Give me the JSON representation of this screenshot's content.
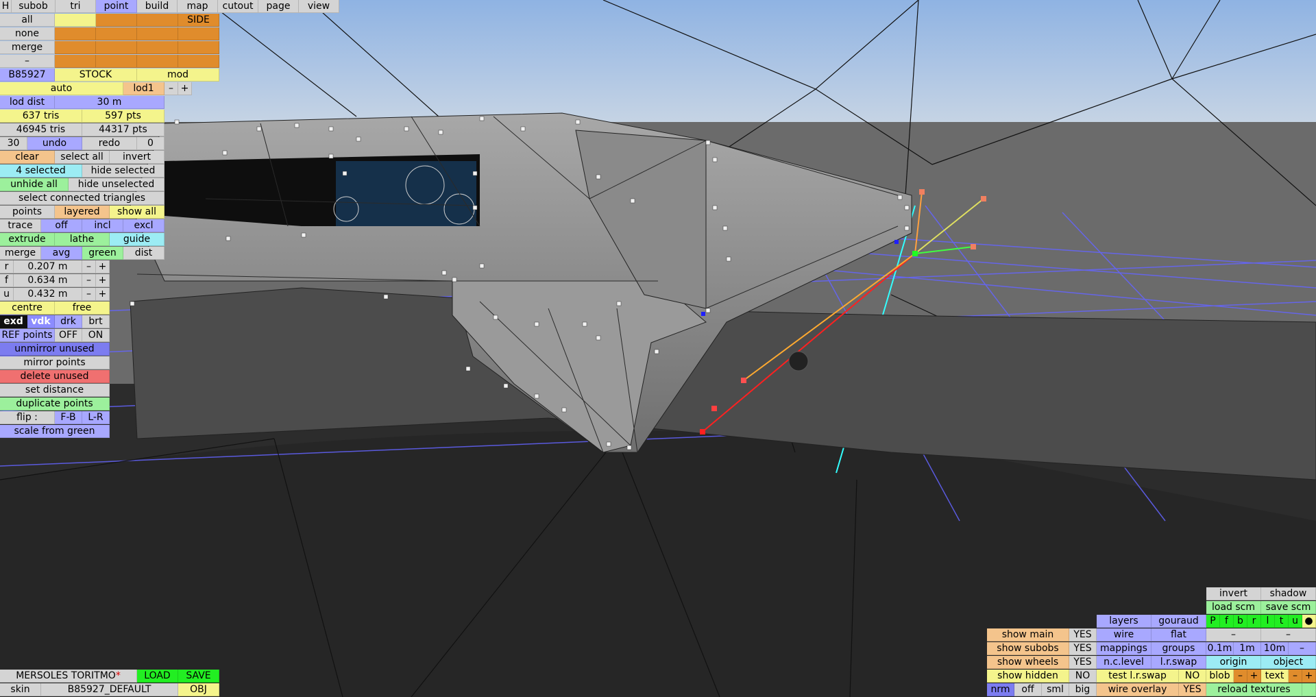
{
  "top_tabs": [
    "H",
    "subob",
    "tri",
    "point",
    "build",
    "map",
    "cutout",
    "page",
    "view"
  ],
  "active_tab": "point",
  "sel_rows": [
    {
      "label": "all",
      "tag": "SIDE"
    },
    {
      "label": "none"
    },
    {
      "label": "merge"
    },
    {
      "label": "–"
    }
  ],
  "car_id": "B85927",
  "stock_label": "STOCK",
  "mod_label": "mod",
  "auto_label": "auto",
  "lod_label": "lod1",
  "minus": "–",
  "plus": "+",
  "lod_dist_label": "lod dist",
  "lod_dist_value": "30 m",
  "tris_lod": "637 tris",
  "pts_lod": "597 pts",
  "tris_total": "46945 tris",
  "pts_total": "44317 pts",
  "undo_count": "30",
  "undo": "undo",
  "redo": "redo",
  "redo_count": "0",
  "clear": "clear",
  "select_all": "select all",
  "invert": "invert",
  "selected_count": "4 selected",
  "hide_selected": "hide selected",
  "unhide_all": "unhide all",
  "hide_unselected": "hide unselected",
  "select_connected": "select connected triangles",
  "points": "points",
  "layered": "layered",
  "show_all": "show all",
  "trace": "trace",
  "off": "off",
  "incl": "incl",
  "excl": "excl",
  "extrude": "extrude",
  "lathe": "lathe",
  "guide": "guide",
  "merge": "merge",
  "avg": "avg",
  "green": "green",
  "dist": "dist",
  "coords": [
    {
      "axis": "r",
      "value": "0.207 m"
    },
    {
      "axis": "f",
      "value": "0.634 m"
    },
    {
      "axis": "u",
      "value": "0.432 m"
    }
  ],
  "centre": "centre",
  "free": "free",
  "exd": "exd",
  "vdk": "vdk",
  "drk": "drk",
  "brt": "brt",
  "ref_points": "REF points",
  "ref_off": "OFF",
  "ref_on": "ON",
  "unmirror_unused": "unmirror unused",
  "mirror_points": "mirror points",
  "delete_unused": "delete unused",
  "set_distance": "set distance",
  "duplicate_points": "duplicate points",
  "flip": "flip :",
  "flip_fb": "F-B",
  "flip_lr": "L-R",
  "scale_from_green": "scale from green",
  "car_name": "MERSOLES TORITMO",
  "modified_mark": "*",
  "load": "LOAD",
  "save": "SAVE",
  "skin_label": "skin",
  "skin_value": "B85927_DEFAULT",
  "obj": "OBJ",
  "br": {
    "invert": "invert",
    "shadow": "shadow",
    "load_scm": "load scm",
    "save_scm": "save scm",
    "layers": "layers",
    "gouraud": "gouraud",
    "layer_flags": [
      "P",
      "f",
      "b",
      "r",
      "l",
      "t",
      "u",
      "●"
    ],
    "wire": "wire",
    "flat": "flat",
    "mappings": "mappings",
    "groups": "groups",
    "steps": [
      "0.1m",
      "1m",
      "10m",
      "–"
    ],
    "nclevel": "n.c.level",
    "lrswap": "l.r.swap",
    "origin": "origin",
    "object": "object",
    "test_lrswap": "test l.r.swap",
    "test_lrswap_val": "NO",
    "blob": "blob",
    "text": "text",
    "wire_overlay": "wire overlay",
    "wire_overlay_val": "YES",
    "reload_textures": "reload textures",
    "show_main": "show main",
    "show_main_val": "YES",
    "show_subobs": "show subobs",
    "show_subobs_val": "YES",
    "show_wheels": "show wheels",
    "show_wheels_val": "YES",
    "show_hidden": "show hidden",
    "show_hidden_val": "NO",
    "nrm": "nrm",
    "off": "off",
    "sml": "sml",
    "big": "big"
  },
  "colors": {
    "sky": "#a9c7ea",
    "floor": "#2a2a2a",
    "mesh": "#8d8d8d",
    "grid": "#6060ff",
    "accent_orange": "#e08c2c"
  }
}
